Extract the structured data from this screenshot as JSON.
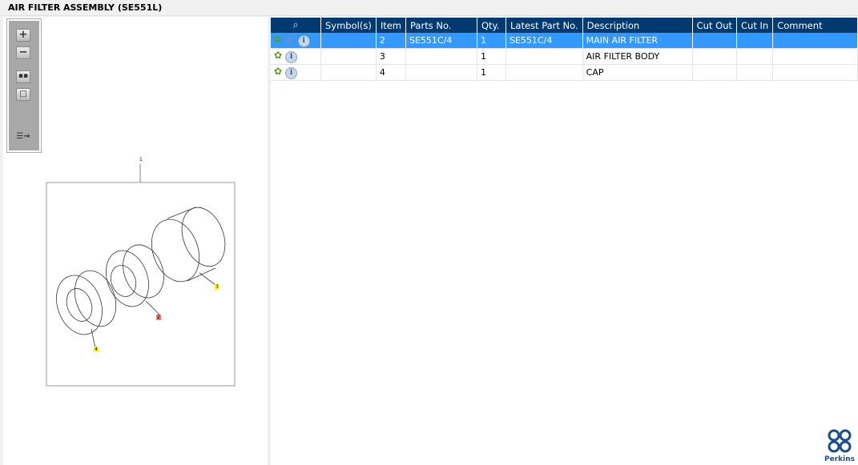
{
  "title": "AIR FILTER ASSEMBLY (SE551L)",
  "toolbar": {
    "icons": [
      "zoom-in-icon",
      "zoom-out-icon",
      "fit-all-icon",
      "fit-window-icon",
      "show-list-icon"
    ]
  },
  "drawing": {
    "labels": {
      "assembly": "1",
      "item2": "2",
      "item3": "3",
      "item4": "4"
    }
  },
  "table": {
    "columns": [
      "",
      "Symbol(s)",
      "Item",
      "Parts No.",
      "Qty.",
      "Latest Part No.",
      "Description",
      "Cut Out",
      "Cut In",
      "Comment"
    ],
    "rows": [
      {
        "symbols": "",
        "item": "2",
        "parts_no": "SE551C/4",
        "qty": "1",
        "latest": "SE551C/4",
        "description": "MAIN AIR FILTER",
        "cut_out": "",
        "cut_in": "",
        "comment": ""
      },
      {
        "symbols": "",
        "item": "3",
        "parts_no": "",
        "qty": "1",
        "latest": "",
        "description": "AIR FILTER BODY",
        "cut_out": "",
        "cut_in": "",
        "comment": ""
      },
      {
        "symbols": "",
        "item": "4",
        "parts_no": "",
        "qty": "1",
        "latest": "",
        "description": "CAP",
        "cut_out": "",
        "cut_in": "",
        "comment": ""
      }
    ]
  },
  "brand": {
    "name": "Perkins",
    "color": "#1a4d8f"
  },
  "colors": {
    "header": "#003a70",
    "selected": "#3399ff"
  }
}
